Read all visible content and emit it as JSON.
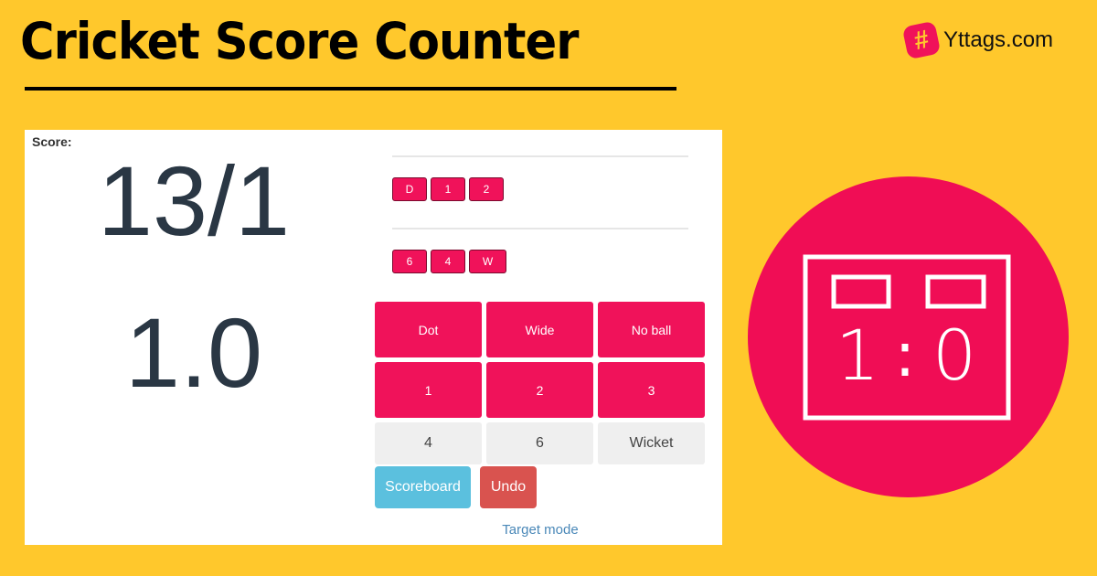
{
  "header": {
    "title": "Cricket Score Counter",
    "brand_icon": "hashtag-icon",
    "brand_glyph": "#",
    "brand_name": "Yttags.com"
  },
  "colors": {
    "background": "#FFC82C",
    "accent": "#F0125A",
    "info": "#5BC0DE",
    "danger": "#D9534F",
    "score_text": "#2A3744",
    "link": "#4A88B8"
  },
  "scoreboard": {
    "score_label": "Score:",
    "score": "13/1",
    "overs": "1.0"
  },
  "over_history": [
    {
      "balls": [
        "D",
        "1",
        "2"
      ]
    },
    {
      "balls": [
        "6",
        "4",
        "W"
      ]
    }
  ],
  "controls": {
    "buttons": [
      {
        "label": "Dot",
        "style": "red"
      },
      {
        "label": "Wide",
        "style": "red"
      },
      {
        "label": "No ball",
        "style": "red"
      },
      {
        "label": "1",
        "style": "red"
      },
      {
        "label": "2",
        "style": "red"
      },
      {
        "label": "3",
        "style": "red"
      },
      {
        "label": "4",
        "style": "grey"
      },
      {
        "label": "6",
        "style": "grey"
      },
      {
        "label": "Wicket",
        "style": "grey"
      }
    ],
    "scoreboard_label": "Scoreboard",
    "undo_label": "Undo",
    "target_mode_label": "Target mode"
  },
  "illustration": {
    "icon": "scoreboard-icon",
    "left_value": "1",
    "separator": ":",
    "right_value": "0"
  }
}
